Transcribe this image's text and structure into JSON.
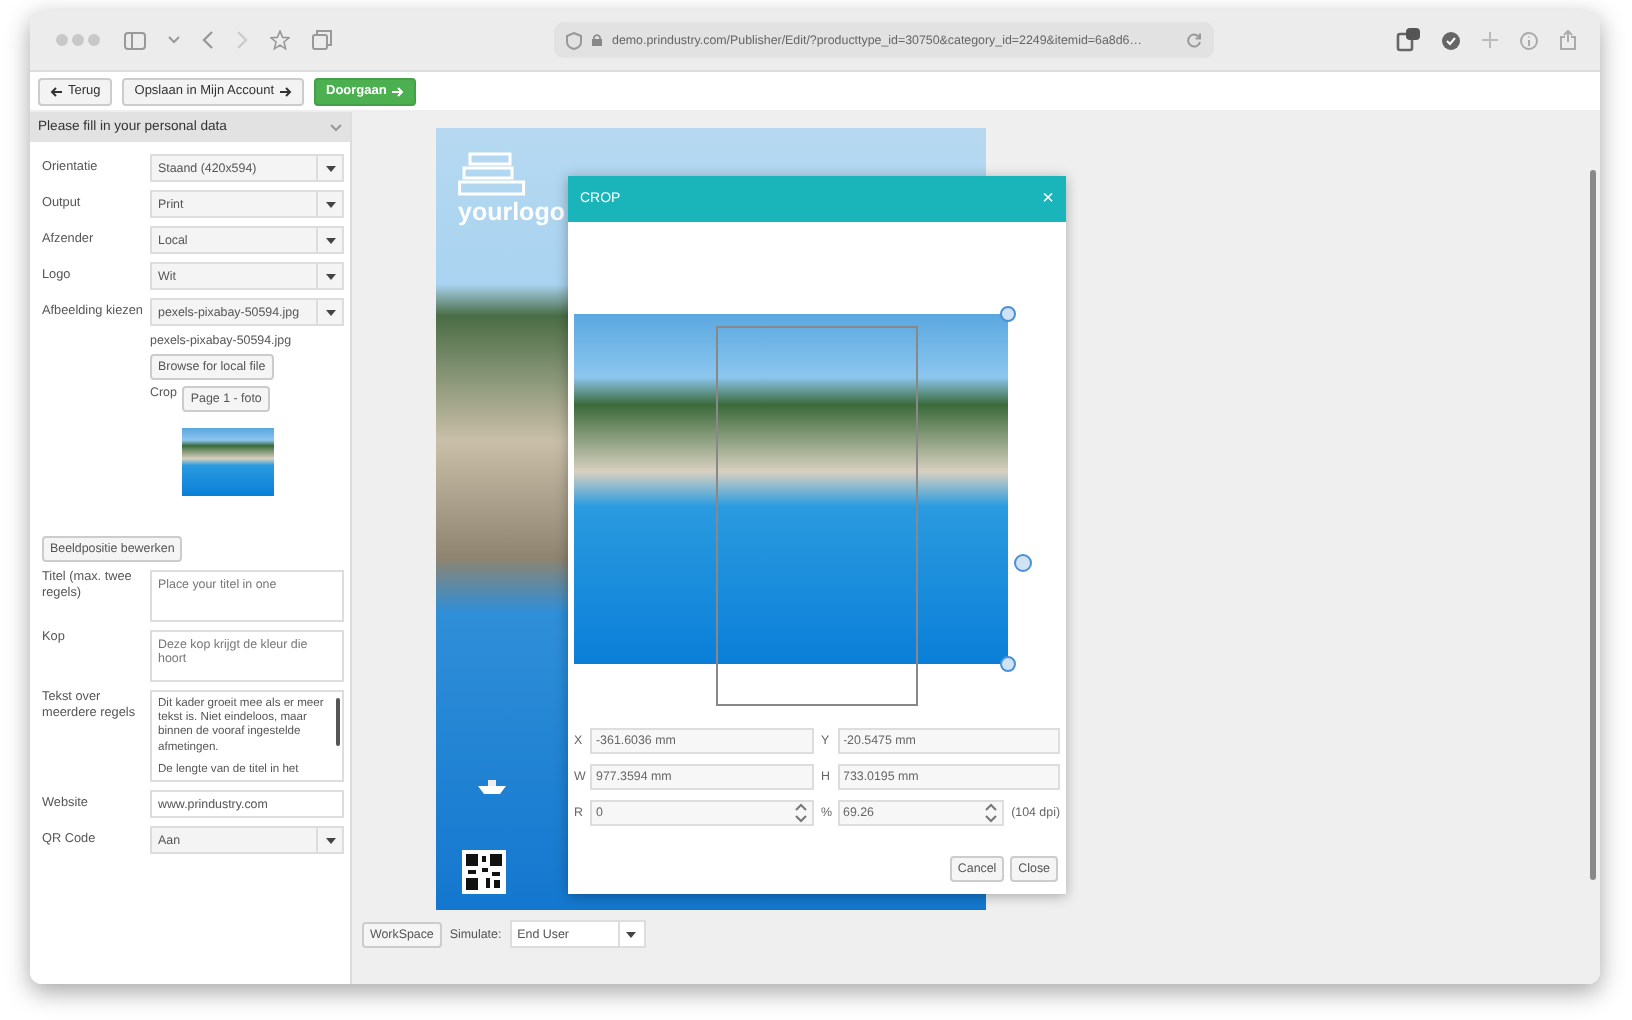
{
  "browser": {
    "url": "demo.prindustry.com/Publisher/Edit/?producttype_id=30750&category_id=2249&itemid=6a8d6…"
  },
  "toolbar": {
    "buttons": [
      {
        "label": "Terug",
        "kind": "back"
      },
      {
        "label": "Opslaan in Mijn Account",
        "kind": "save"
      },
      {
        "label": "Doorgaan",
        "kind": "next"
      }
    ]
  },
  "panel": {
    "title": "Please fill in your personal data",
    "expanded": true,
    "fields": [
      {
        "kind": "select",
        "label": "Orientatie",
        "value": "Staand (420x594)"
      },
      {
        "kind": "select",
        "label": "Output",
        "value": "Print"
      },
      {
        "kind": "select",
        "label": "Afzender",
        "value": "Local"
      },
      {
        "kind": "select",
        "label": "Logo",
        "value": "Wit"
      },
      {
        "kind": "image",
        "label": "Afbeelding kiezen",
        "value": "pexels-pixabay-50594.jpg",
        "filename": "pexels-pixabay-50594.jpg",
        "browse": "Browse for local file",
        "crop_label": "Crop",
        "crop_button": "Page 1 - foto"
      },
      {
        "kind": "button",
        "label": "Beeldpositie bewerken"
      },
      {
        "kind": "textarea",
        "label": "Titel (max. twee regels)",
        "placeholder": "Place your titel in one"
      },
      {
        "kind": "textarea",
        "label": "Kop",
        "placeholder": "Deze kop krijgt de kleur die hoort"
      },
      {
        "kind": "longtext",
        "label": "Tekst over meerdere regels",
        "paragraphs": [
          "Dit kader groeit mee als er meer tekst is. Niet eindeloos, maar binnen de vooraf ingestelde afmetingen.",
          "De lengte van de titel in het"
        ]
      },
      {
        "kind": "input",
        "label": "Website",
        "value": "www.prindustry.com"
      },
      {
        "kind": "select",
        "label": "QR Code",
        "value": "Aan"
      }
    ]
  },
  "poster": {
    "logo_text": "yourlogo"
  },
  "crop_dialog": {
    "title": "CROP",
    "close": "×",
    "fields": [
      {
        "label": "X",
        "value": "-361.6036 mm",
        "kind": "text"
      },
      {
        "label": "Y",
        "value": "-20.5475 mm",
        "kind": "text"
      },
      {
        "label": "W",
        "value": "977.3594 mm",
        "kind": "text"
      },
      {
        "label": "H",
        "value": "733.0195 mm",
        "kind": "text"
      },
      {
        "label": "R",
        "value": "0",
        "kind": "spinner"
      },
      {
        "label": "%",
        "value": "69.26",
        "kind": "spinner"
      }
    ],
    "dpi": "(104 dpi)",
    "buttons": [
      "Cancel",
      "Close"
    ]
  },
  "bottom_bar": {
    "workspace": "WorkSpace",
    "simulate_label": "Simulate:",
    "simulate_value": "End User"
  }
}
